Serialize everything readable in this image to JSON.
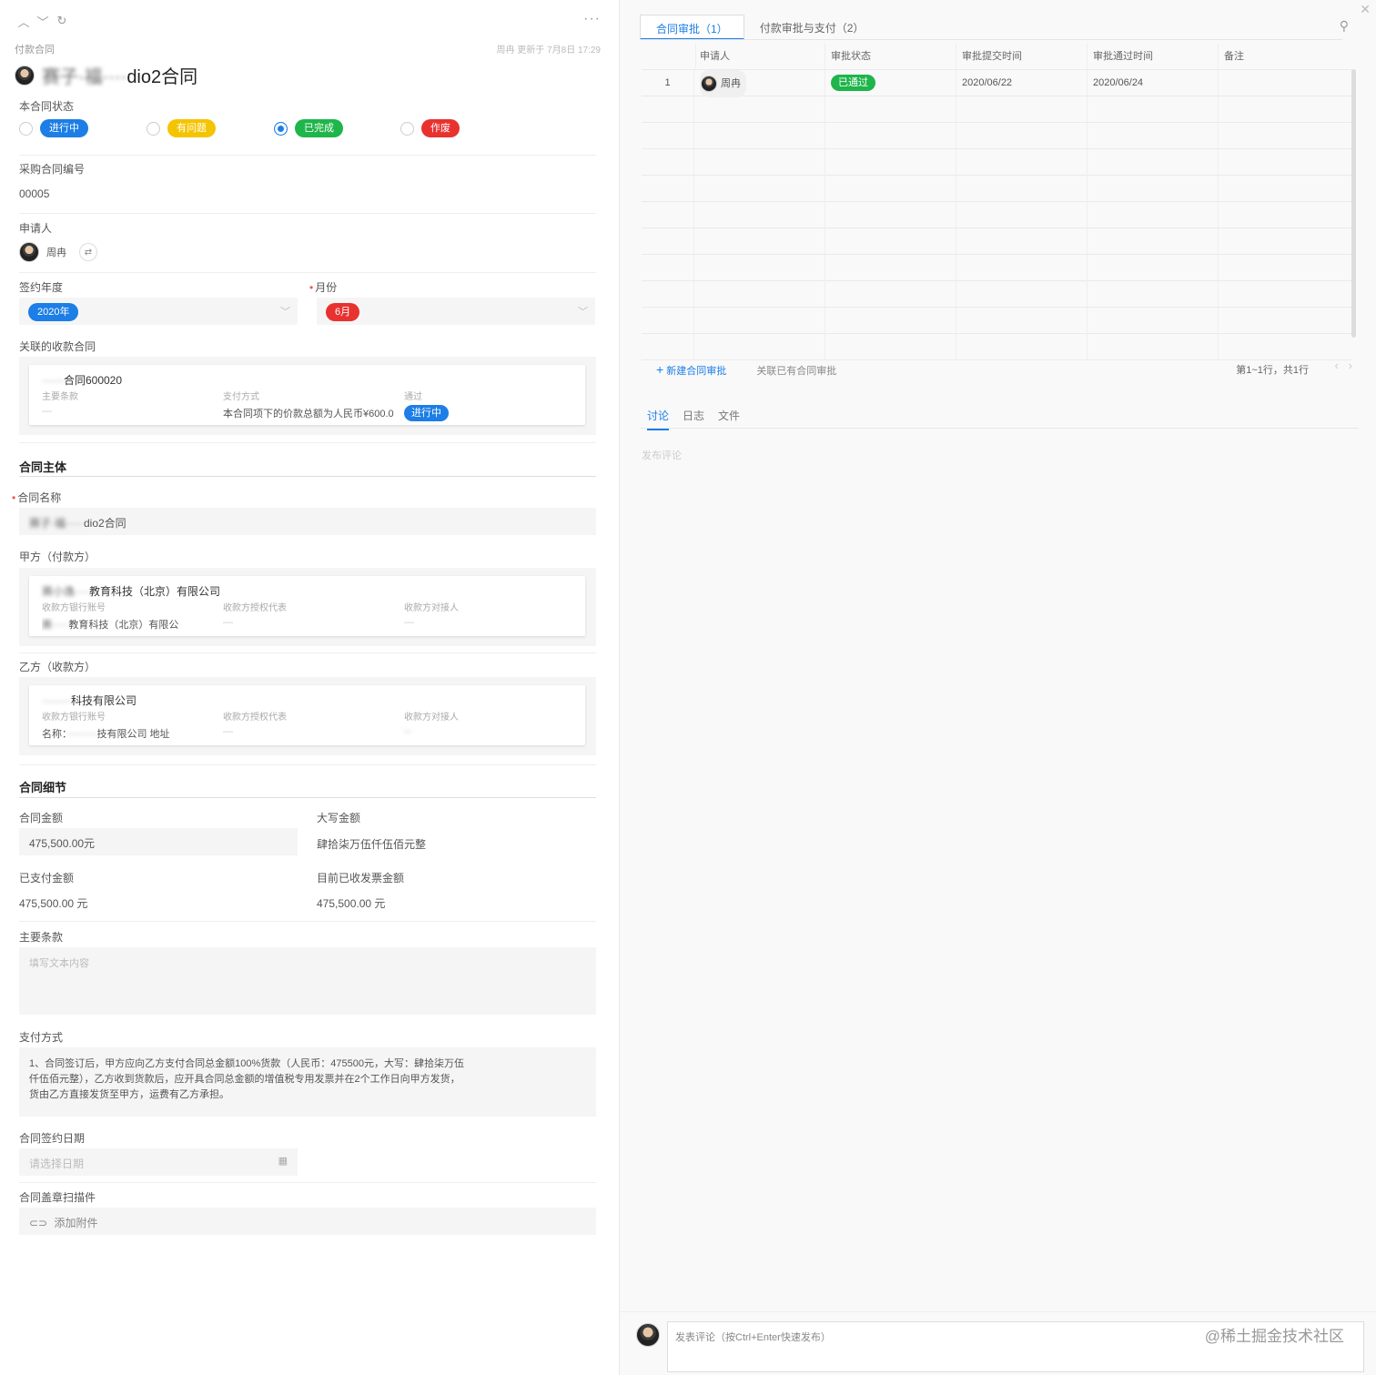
{
  "left": {
    "topbar_icons": [
      "chevron-up-icon",
      "chevron-down-icon",
      "refresh-icon",
      "more-icon"
    ],
    "breadcrumb": "付款合同",
    "updated_text": "周冉 更新于 7月8日 17:29",
    "title_blurred": "赛子·福····",
    "title_suffix": "dio2合同",
    "status": {
      "label": "本合同状态",
      "options": [
        {
          "label": "进行中",
          "color": "#1c7ee6",
          "checked": false
        },
        {
          "label": "有问题",
          "color": "#f5c400",
          "checked": false
        },
        {
          "label": "已完成",
          "color": "#1eb54a",
          "checked": true
        },
        {
          "label": "作废",
          "color": "#e8322f",
          "checked": false
        }
      ]
    },
    "purchase_no": {
      "label": "采购合同编号",
      "value": "00005"
    },
    "applicant": {
      "label": "申请人",
      "name": "周冉"
    },
    "sign_year": {
      "label": "签约年度",
      "value": "2020年",
      "color": "#1c7ee6"
    },
    "month": {
      "label": "月份",
      "value": "6月",
      "color": "#e8322f"
    },
    "related": {
      "label": "关联的收款合同",
      "title_blurred": "······",
      "title_suffix": "合同600020",
      "col1_key": "主要条款",
      "col1_val": "—",
      "col2_key": "支付方式",
      "col2_val": "本合同项下的价款总额为人民币¥600.0",
      "col3_key": "通过",
      "col3_tag": "进行中"
    },
    "section_subject": "合同主体",
    "contract_name": {
      "label": "合同名称",
      "value_blurred": "赛子·福·····",
      "value_suffix": "dio2合同"
    },
    "party_a": {
      "label": "甲方（付款方）",
      "title_blurred": "赛小逸····",
      "title_suffix": "教育科技（北京）有限公司",
      "col1_key": "收款方银行账号",
      "col1_val_blurred": "赛·····",
      "col1_val": "教育科技（北京）有限公",
      "col2_key": "收款方授权代表",
      "col2_val": "—",
      "col3_key": "收款方对接人",
      "col3_val": "—"
    },
    "party_b": {
      "label": "乙方（收款方）",
      "title_blurred": "········",
      "title_suffix": "科技有限公司",
      "col1_key": "收款方银行账号",
      "col1_val_prefix": "名称：",
      "col1_val_blurred": "·········",
      "col1_val": "技有限公司 地址",
      "col2_key": "收款方授权代表",
      "col2_val": "—",
      "col3_key": "收款方对接人",
      "col3_val_blurred": "··"
    },
    "section_detail": "合同细节",
    "amount": {
      "label": "合同金额",
      "value": "475,500.00元"
    },
    "amount_upper": {
      "label": "大写金额",
      "value": "肆拾柒万伍仟伍佰元整"
    },
    "paid": {
      "label": "已支付金额",
      "value": "475,500.00 元"
    },
    "invoiced": {
      "label": "目前已收发票金额",
      "value": "475,500.00 元"
    },
    "main_terms": {
      "label": "主要条款",
      "placeholder": "填写文本内容"
    },
    "payment": {
      "label": "支付方式",
      "lines": [
        "1、合同签订后，甲方应向乙方支付合同总金额100%货款（人民币：475500元，大写：肆拾柒万伍",
        "仟伍佰元整），乙方收到货款后，应开具合同总金额的增值税专用发票并在2个工作日向甲方发货，",
        "货由乙方直接发货至甲方，运费有乙方承担。"
      ]
    },
    "sign_date": {
      "label": "合同签约日期",
      "placeholder": "请选择日期"
    },
    "scan": {
      "label": "合同盖章扫描件",
      "add": "添加附件"
    }
  },
  "right": {
    "tabs": [
      "合同审批（1）",
      "付款审批与支付（2）"
    ],
    "table": {
      "headers": [
        "申请人",
        "审批状态",
        "审批提交时间",
        "审批通过时间",
        "备注"
      ],
      "rows": [
        {
          "index": "1",
          "applicant": "周冉",
          "status": "已通过",
          "submitted": "2020/06/22",
          "approved": "2020/06/24",
          "note": ""
        }
      ],
      "status_color": "#1eb54a"
    },
    "new_approval": "新建合同审批",
    "link_existing": "关联已有合同审批",
    "pagination": "第1~1行，共1行",
    "subtabs": [
      "讨论",
      "日志",
      "文件"
    ],
    "post_hint": "发布评论",
    "comment_placeholder": "发表评论（按Ctrl+Enter快速发布）",
    "watermark": "@稀土掘金技术社区"
  }
}
